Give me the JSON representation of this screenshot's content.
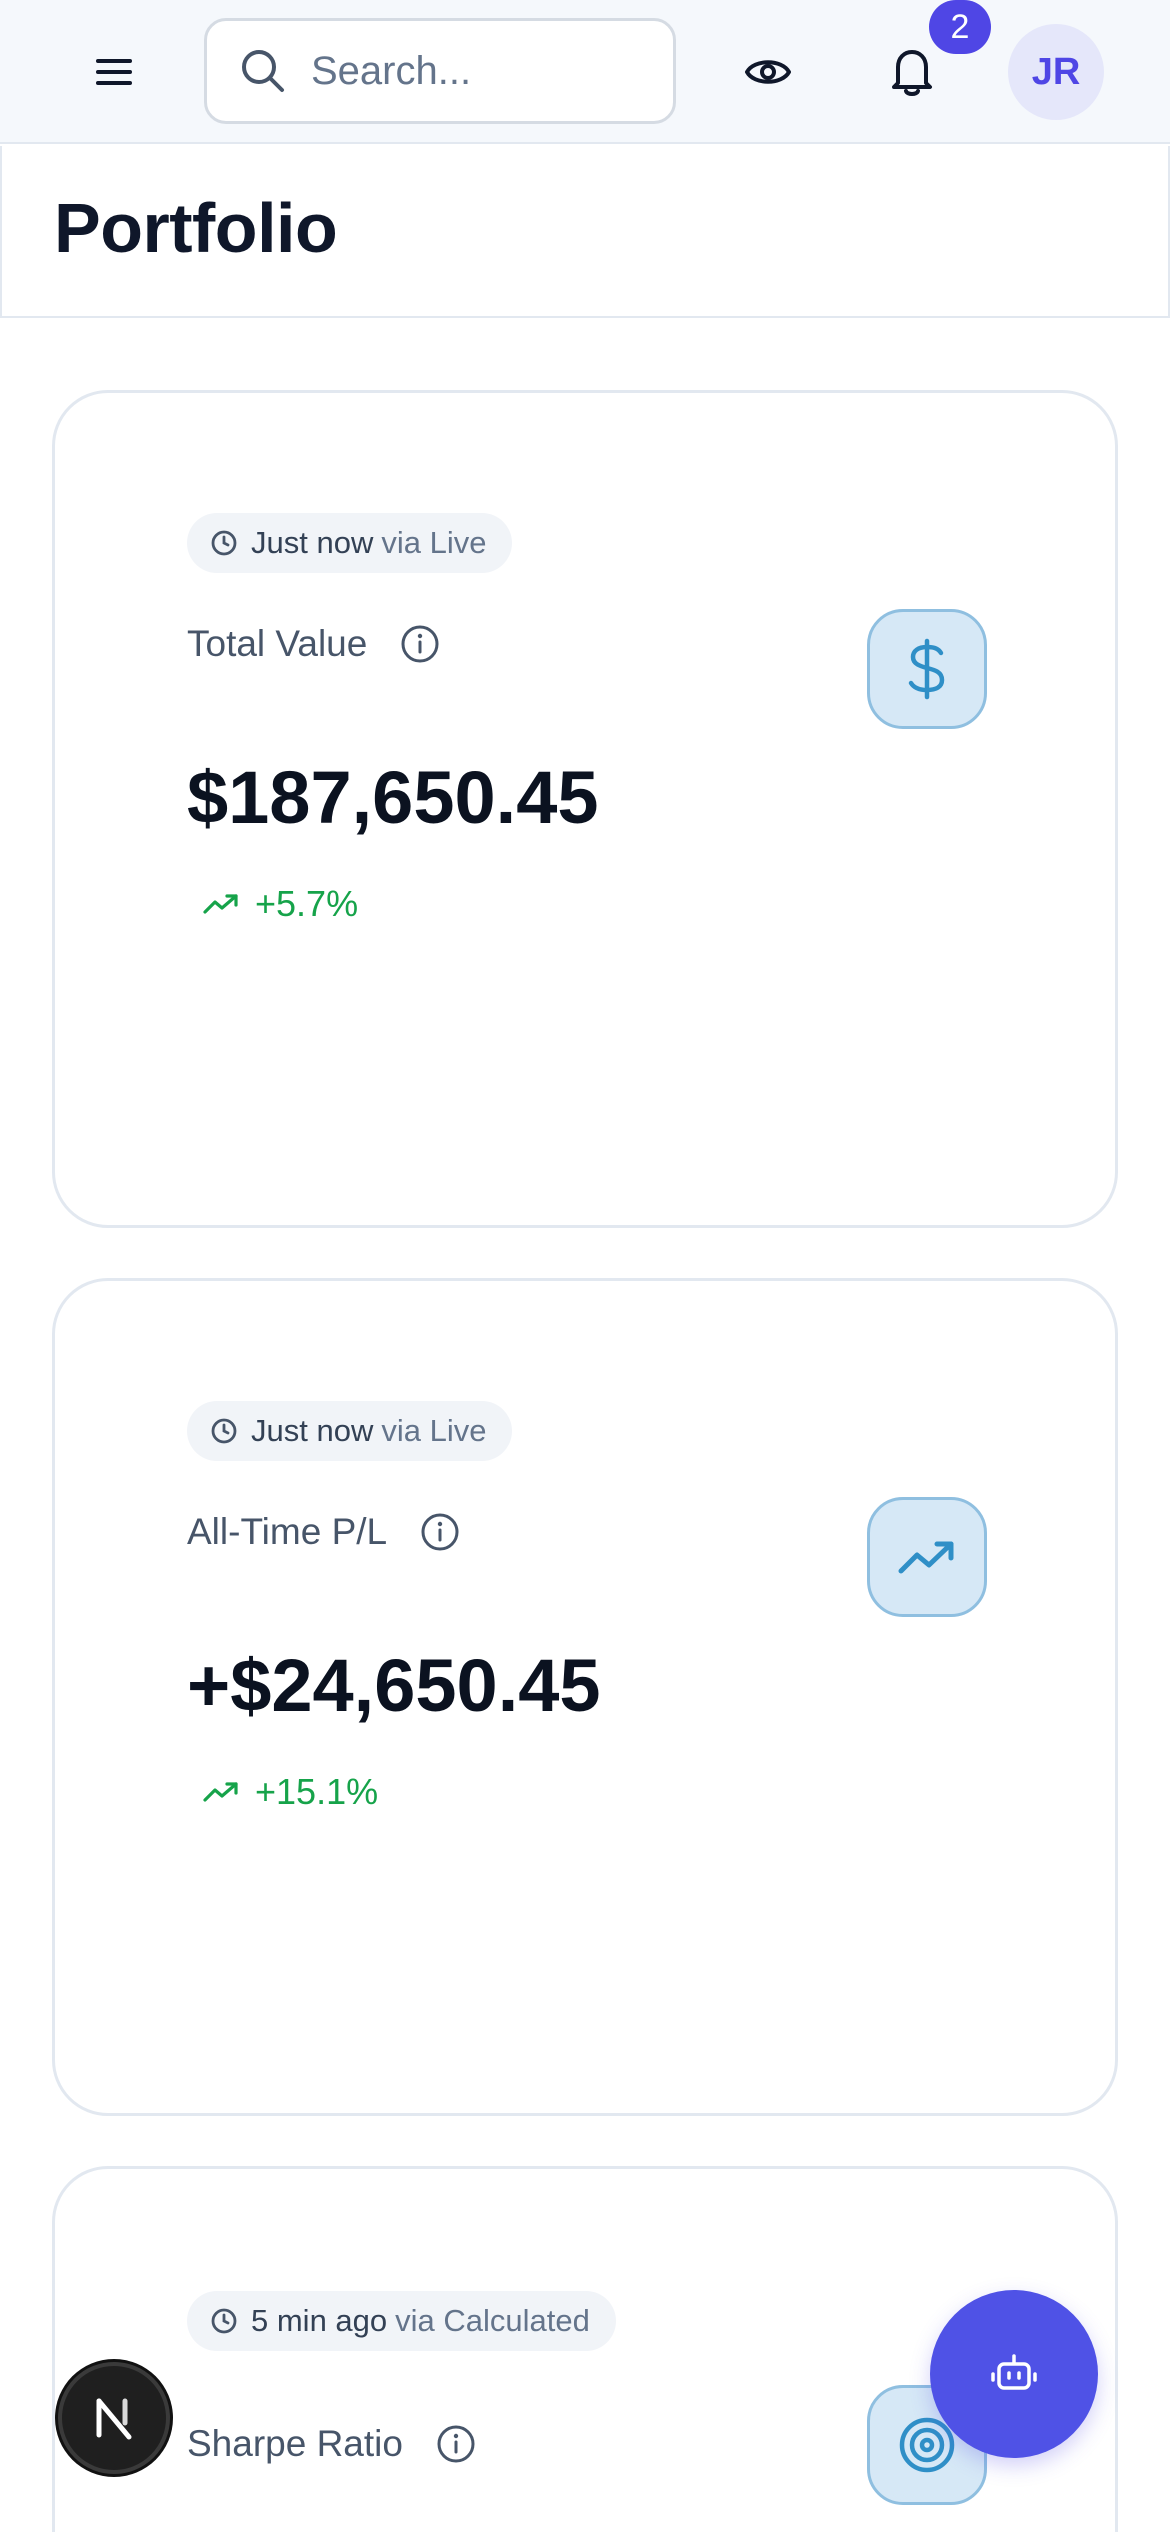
{
  "header": {
    "search_placeholder": "Search...",
    "notification_count": "2",
    "avatar_initials": "JR"
  },
  "page": {
    "title": "Portfolio"
  },
  "cards": [
    {
      "updated": "Just now",
      "source": "via Live",
      "label": "Total Value",
      "value": "$187,650.45",
      "change": "+5.7%",
      "icon": "dollar-icon"
    },
    {
      "updated": "Just now",
      "source": "via Live",
      "label": "All-Time P/L",
      "value": "+$24,650.45",
      "change": "+15.1%",
      "icon": "trending-up-icon"
    },
    {
      "updated": "5 min ago",
      "source": "via Calculated",
      "label": "Sharpe Ratio",
      "icon": "target-icon"
    }
  ],
  "colors": {
    "accent": "#4f46e5",
    "positive": "#16a34a",
    "icon_blue": "#2f8fc7"
  }
}
